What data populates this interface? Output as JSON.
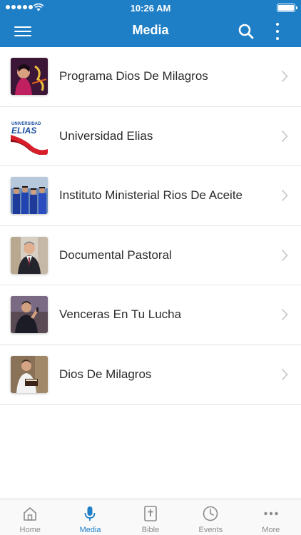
{
  "status_bar": {
    "time": "10:26 AM"
  },
  "nav": {
    "title": "Media"
  },
  "list": [
    {
      "label": "Programa Dios De Milagros",
      "thumb": "program-art"
    },
    {
      "label": "Universidad Elias",
      "thumb": "university-logo",
      "thumb_text_top": "UNIVERSIDAD",
      "thumb_text_main": "ELIAS"
    },
    {
      "label": "Instituto Ministerial Rios De Aceite",
      "thumb": "graduates-photo"
    },
    {
      "label": "Documental Pastoral",
      "thumb": "pastor-photo"
    },
    {
      "label": "Venceras En Tu Lucha",
      "thumb": "preacher-photo"
    },
    {
      "label": "Dios De Milagros",
      "thumb": "reader-photo"
    }
  ],
  "tabs": [
    {
      "label": "Home",
      "icon": "home-icon"
    },
    {
      "label": "Media",
      "icon": "microphone-icon",
      "active": true
    },
    {
      "label": "Bible",
      "icon": "bible-icon"
    },
    {
      "label": "Events",
      "icon": "clock-icon"
    },
    {
      "label": "More",
      "icon": "ellipsis-icon"
    }
  ],
  "colors": {
    "accent": "#1f7fc6",
    "tab_inactive": "#8a8a8a",
    "separator": "#e3e3e3"
  }
}
